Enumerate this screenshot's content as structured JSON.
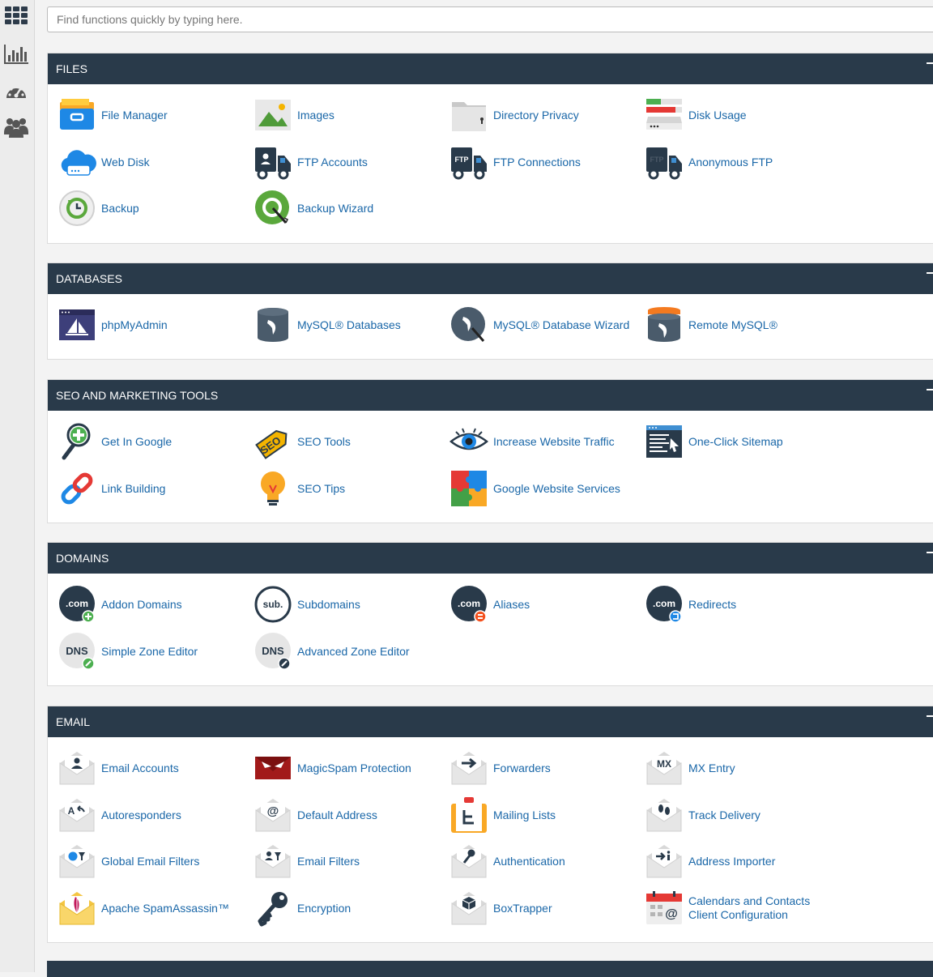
{
  "sidebar": {
    "items": [
      {
        "icon": "apps-grid-icon"
      },
      {
        "icon": "stats-chart-icon"
      },
      {
        "icon": "dashboard-gauge-icon"
      },
      {
        "icon": "users-group-icon"
      }
    ]
  },
  "search": {
    "placeholder": "Find functions quickly by typing here."
  },
  "sections": [
    {
      "title": "FILES",
      "items": [
        {
          "label": "File Manager",
          "icon": "file-manager-icon"
        },
        {
          "label": "Images",
          "icon": "images-icon"
        },
        {
          "label": "Directory Privacy",
          "icon": "directory-privacy-icon"
        },
        {
          "label": "Disk Usage",
          "icon": "disk-usage-icon"
        },
        {
          "label": "Web Disk",
          "icon": "web-disk-icon"
        },
        {
          "label": "FTP Accounts",
          "icon": "ftp-accounts-icon"
        },
        {
          "label": "FTP Connections",
          "icon": "ftp-connections-icon"
        },
        {
          "label": "Anonymous FTP",
          "icon": "anonymous-ftp-icon"
        },
        {
          "label": "Backup",
          "icon": "backup-icon"
        },
        {
          "label": "Backup Wizard",
          "icon": "backup-wizard-icon"
        }
      ]
    },
    {
      "title": "DATABASES",
      "items": [
        {
          "label": "phpMyAdmin",
          "icon": "phpmyadmin-icon"
        },
        {
          "label": "MySQL® Databases",
          "icon": "mysql-databases-icon"
        },
        {
          "label": "MySQL® Database Wizard",
          "icon": "mysql-wizard-icon"
        },
        {
          "label": "Remote MySQL®",
          "icon": "remote-mysql-icon"
        }
      ]
    },
    {
      "title": "SEO AND MARKETING TOOLS",
      "items": [
        {
          "label": "Get In Google",
          "icon": "get-in-google-icon"
        },
        {
          "label": "SEO Tools",
          "icon": "seo-tools-icon"
        },
        {
          "label": "Increase Website Traffic",
          "icon": "website-traffic-icon"
        },
        {
          "label": "One-Click Sitemap",
          "icon": "sitemap-icon"
        },
        {
          "label": "Link Building",
          "icon": "link-building-icon"
        },
        {
          "label": "SEO Tips",
          "icon": "seo-tips-icon"
        },
        {
          "label": "Google Website Services",
          "icon": "google-services-icon"
        }
      ]
    },
    {
      "title": "DOMAINS",
      "items": [
        {
          "label": "Addon Domains",
          "icon": "addon-domains-icon"
        },
        {
          "label": "Subdomains",
          "icon": "subdomains-icon"
        },
        {
          "label": "Aliases",
          "icon": "aliases-icon"
        },
        {
          "label": "Redirects",
          "icon": "redirects-icon"
        },
        {
          "label": "Simple Zone Editor",
          "icon": "simple-zone-editor-icon"
        },
        {
          "label": "Advanced Zone Editor",
          "icon": "advanced-zone-editor-icon"
        }
      ]
    },
    {
      "title": "EMAIL",
      "items": [
        {
          "label": "Email Accounts",
          "icon": "email-accounts-icon"
        },
        {
          "label": "MagicSpam Protection",
          "icon": "magicspam-icon"
        },
        {
          "label": "Forwarders",
          "icon": "forwarders-icon"
        },
        {
          "label": "MX Entry",
          "icon": "mx-entry-icon"
        },
        {
          "label": "Autoresponders",
          "icon": "autoresponders-icon"
        },
        {
          "label": "Default Address",
          "icon": "default-address-icon"
        },
        {
          "label": "Mailing Lists",
          "icon": "mailing-lists-icon"
        },
        {
          "label": "Track Delivery",
          "icon": "track-delivery-icon"
        },
        {
          "label": "Global Email Filters",
          "icon": "global-email-filters-icon"
        },
        {
          "label": "Email Filters",
          "icon": "email-filters-icon"
        },
        {
          "label": "Authentication",
          "icon": "authentication-icon"
        },
        {
          "label": "Address Importer",
          "icon": "address-importer-icon"
        },
        {
          "label": "Apache SpamAssassin™",
          "icon": "spamassassin-icon"
        },
        {
          "label": "Encryption",
          "icon": "encryption-icon"
        },
        {
          "label": "BoxTrapper",
          "icon": "boxtrapper-icon"
        },
        {
          "label": "Calendars and Contacts\nClient Configuration",
          "icon": "calendars-contacts-icon"
        }
      ]
    }
  ]
}
